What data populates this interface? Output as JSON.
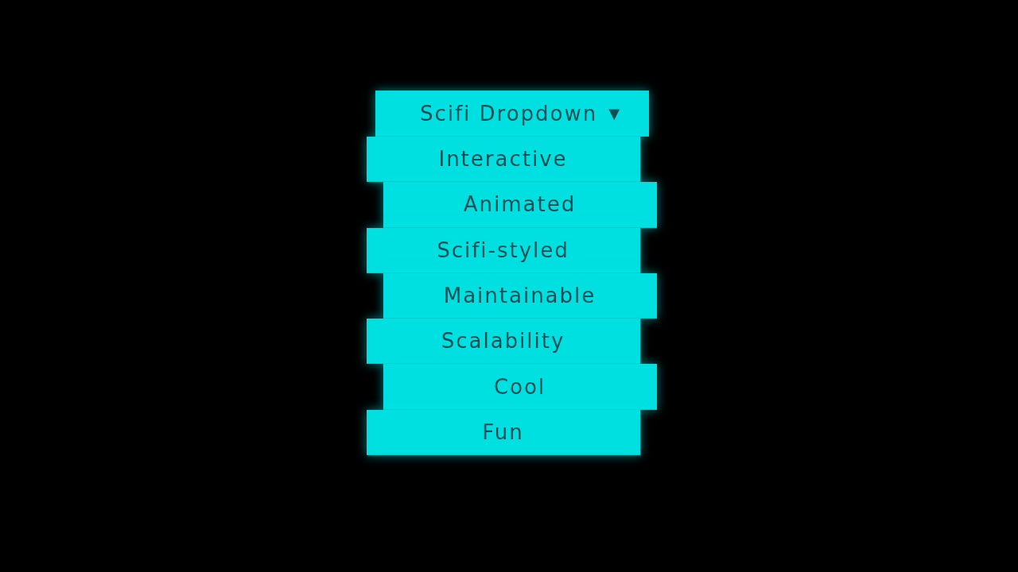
{
  "dropdown": {
    "label": "Scifi Dropdown",
    "caret": "▼"
  },
  "items": [
    {
      "label": "Interactive"
    },
    {
      "label": "Animated"
    },
    {
      "label": "Scifi-styled"
    },
    {
      "label": "Maintainable"
    },
    {
      "label": "Scalability"
    },
    {
      "label": "Cool"
    },
    {
      "label": "Fun"
    }
  ]
}
